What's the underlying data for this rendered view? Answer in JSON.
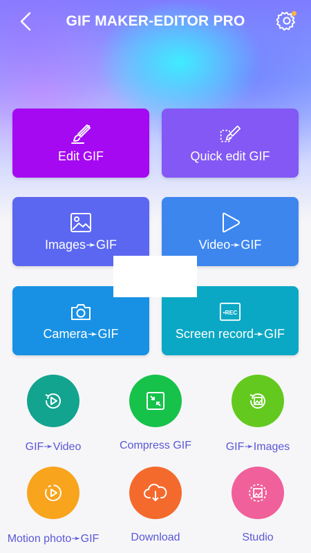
{
  "header": {
    "title": "GIF MAKER-EDITOR PRO"
  },
  "tiles": [
    {
      "label": "Edit GIF",
      "icon": "brush-icon",
      "color": "#a509f2"
    },
    {
      "label": "Quick edit GIF",
      "icon": "lasso-brush-icon",
      "color": "#8358f4"
    },
    {
      "label": "Images➛GIF",
      "icon": "image-icon",
      "color": "#5b67f0"
    },
    {
      "label": "Video➛GIF",
      "icon": "play-icon",
      "color": "#3d86ee"
    },
    {
      "label": "Camera➛GIF",
      "icon": "camera-icon",
      "color": "#1891e4"
    },
    {
      "label": "Screen record➛GIF",
      "icon": "rec-icon",
      "color": "#0aa8c4"
    }
  ],
  "rec_badge": "•REC",
  "circles": [
    {
      "label": "GIF➛Video",
      "icon": "gif-to-video-icon",
      "color": "#12a48e"
    },
    {
      "label": "Compress GIF",
      "icon": "compress-icon",
      "color": "#16c24a"
    },
    {
      "label": "GIF➛Images",
      "icon": "gif-to-images-icon",
      "color": "#63c91f"
    },
    {
      "label": "Motion photo➛GIF",
      "icon": "motion-photo-icon",
      "color": "#f8a41d"
    },
    {
      "label": "Download",
      "icon": "download-cloud-icon",
      "color": "#f46a2d"
    },
    {
      "label": "Studio",
      "icon": "studio-icon",
      "color": "#f0609a"
    }
  ]
}
